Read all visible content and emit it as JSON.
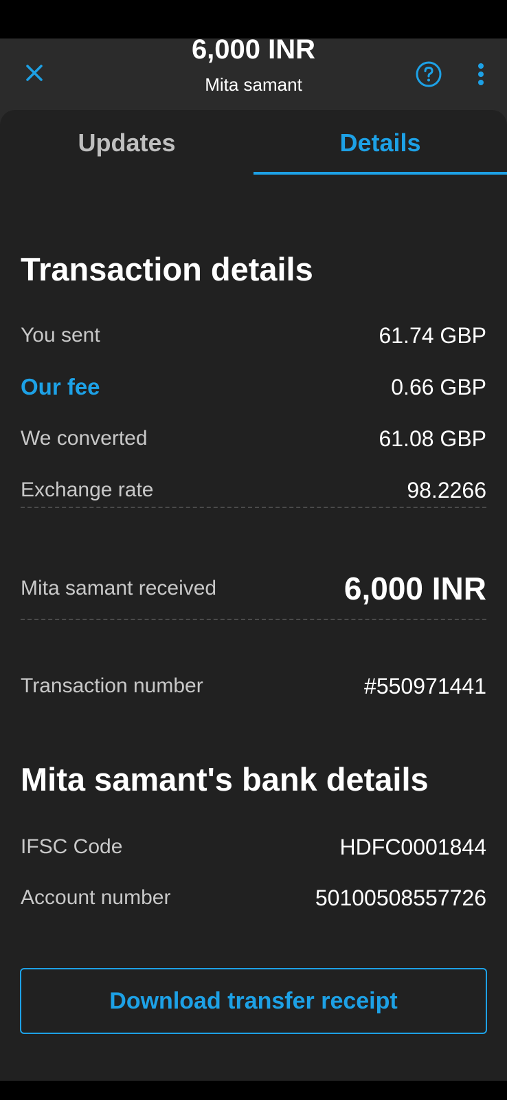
{
  "header": {
    "amount": "6,000 INR",
    "recipient": "Mita samant",
    "close_icon": "close-icon",
    "help_icon": "help-circle-icon",
    "more_icon": "more-vertical-icon"
  },
  "tabs": [
    {
      "label": "Updates",
      "active": false
    },
    {
      "label": "Details",
      "active": true
    }
  ],
  "transaction": {
    "title": "Transaction details",
    "rows": [
      {
        "label": "You sent",
        "value": "61.74 GBP"
      },
      {
        "label": "Our fee",
        "value": "0.66 GBP"
      },
      {
        "label": "We converted",
        "value": "61.08 GBP"
      },
      {
        "label": "Exchange rate",
        "value": "98.2266"
      }
    ],
    "received_label": "Mita samant received",
    "received_value": "6,000 INR",
    "number_label": "Transaction number",
    "number_value": "#550971441"
  },
  "bank": {
    "title": "Mita samant's bank details",
    "rows": [
      {
        "label": "IFSC Code",
        "value": "HDFC0001844"
      },
      {
        "label": "Account number",
        "value": "50100508557726"
      }
    ]
  },
  "actions": {
    "download_label": "Download transfer receipt"
  },
  "colors": {
    "accent": "#1da1e6",
    "panel": "#212121",
    "header": "#2b2b2b"
  }
}
